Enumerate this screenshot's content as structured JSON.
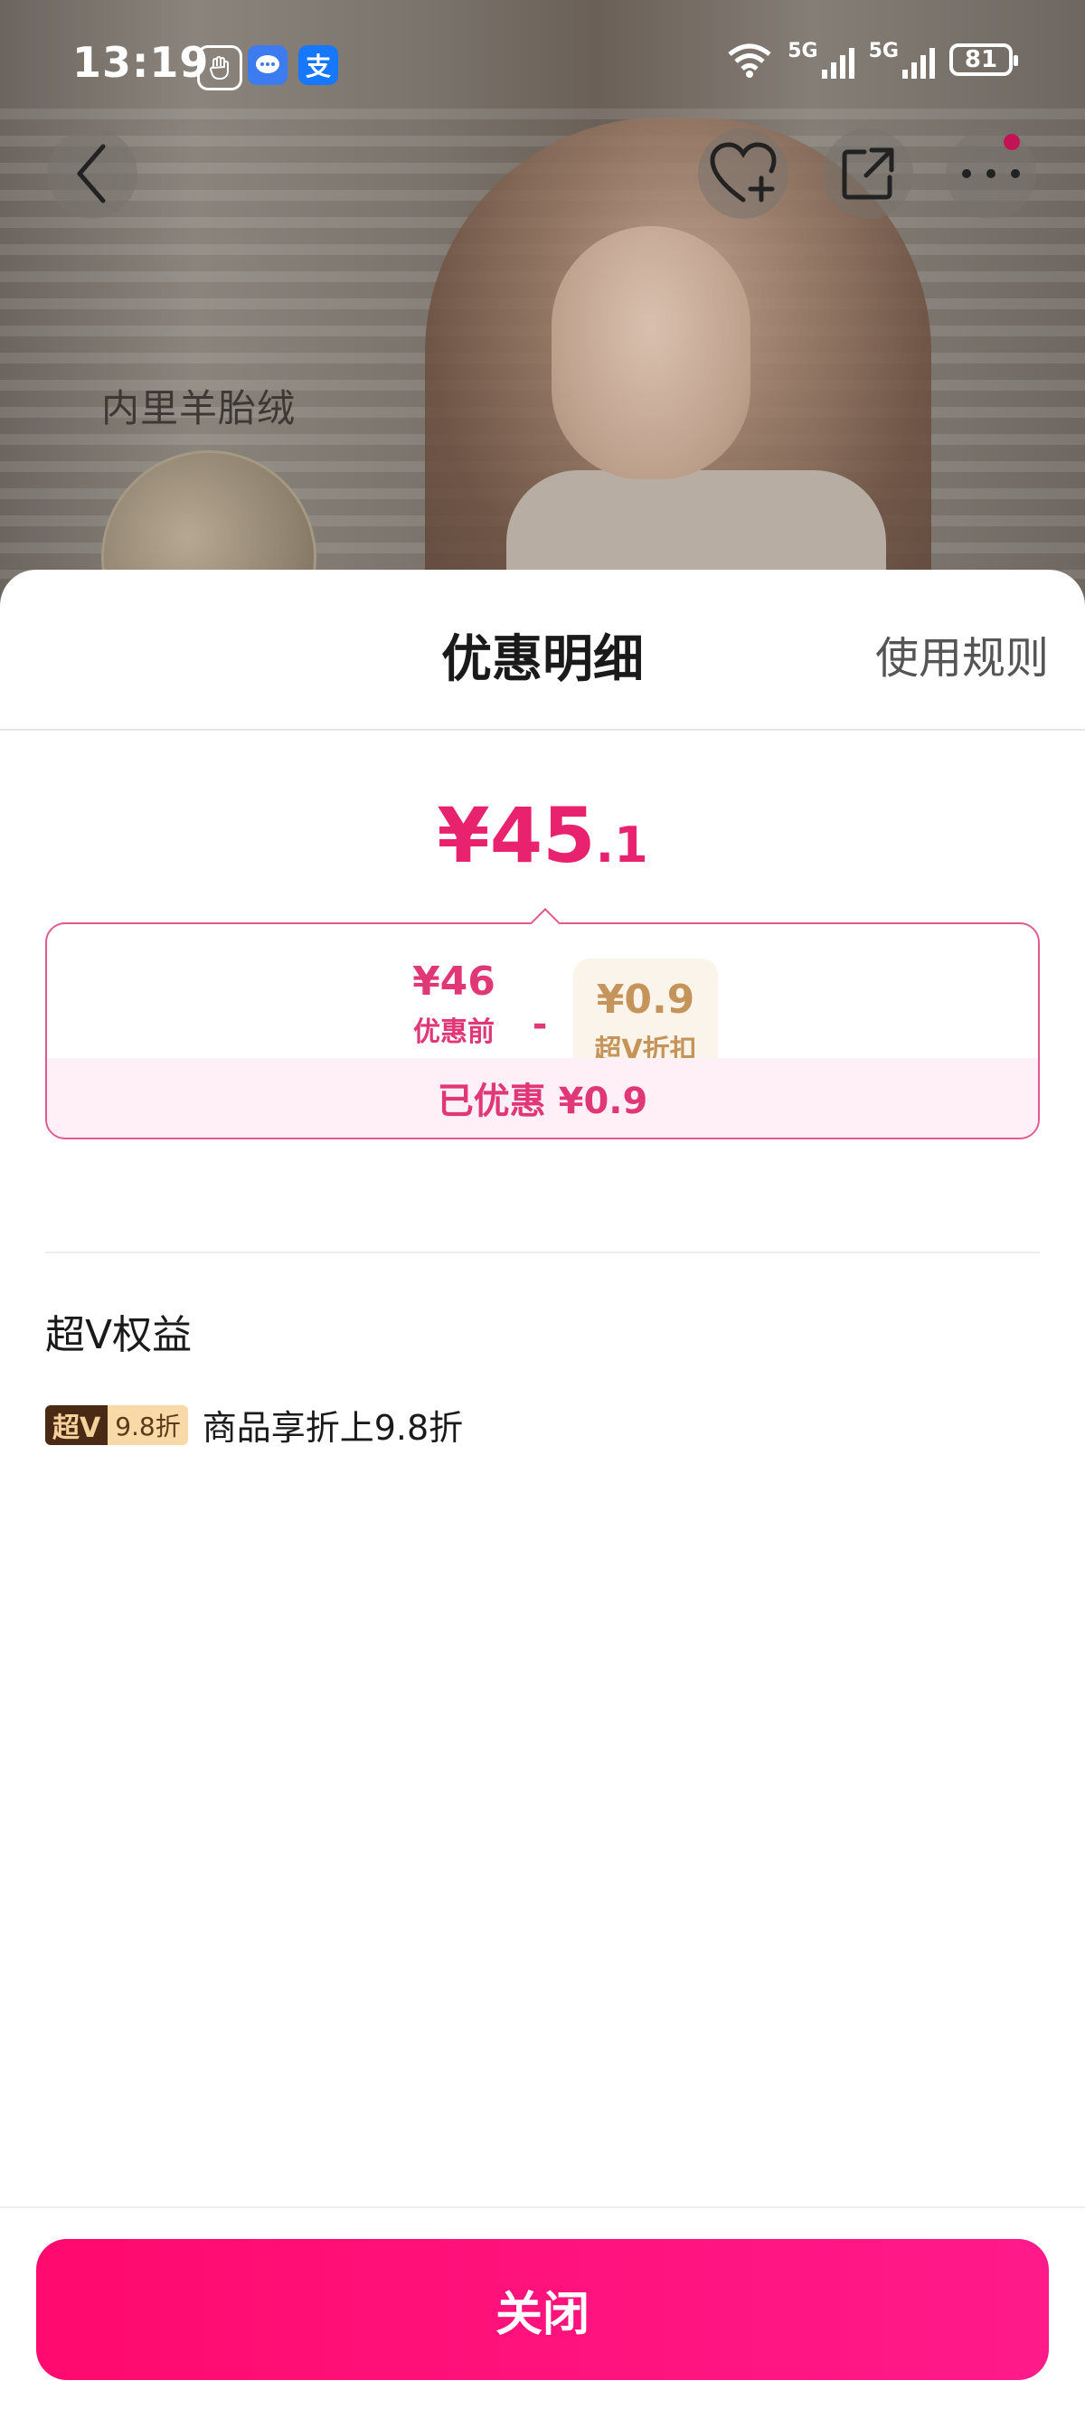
{
  "status_bar": {
    "time": "13:19",
    "battery": "81",
    "net1": "5G",
    "net2": "5G",
    "alipay_glyph": "支"
  },
  "product_header": {
    "fabric_label": "内里羊胎绒"
  },
  "sheet": {
    "title": "优惠明细",
    "rules_link": "使用规则"
  },
  "price": {
    "final_big": "¥45",
    "final_small": ".1",
    "before_amount": "¥46",
    "before_label": "优惠前",
    "minus": "-",
    "coupon_amount": "¥0.9",
    "coupon_label": "超V折扣",
    "saved_text": "已优惠 ¥0.9"
  },
  "perks": {
    "title": "超V权益",
    "items": [
      {
        "tag_left": "超V",
        "tag_right": "9.8折",
        "text": "商品享折上9.8折"
      }
    ]
  },
  "footer": {
    "close_label": "关闭"
  },
  "colors": {
    "accent": "#e8226e",
    "button_start": "#ff0a6e",
    "button_end": "#ff1a8a",
    "coupon_gold": "#c4945a"
  }
}
